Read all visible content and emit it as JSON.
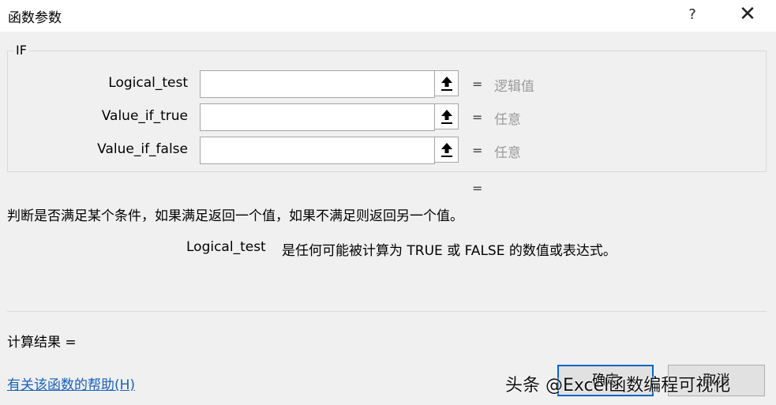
{
  "window": {
    "title": "函数参数",
    "help_glyph": "?",
    "close_glyph": "✕"
  },
  "function": {
    "name": "IF",
    "args": [
      {
        "label": "Logical_test",
        "value": "",
        "type": "逻辑值"
      },
      {
        "label": "Value_if_true",
        "value": "",
        "type": "任意"
      },
      {
        "label": "Value_if_false",
        "value": "",
        "type": "任意"
      }
    ],
    "equals": "=",
    "result_equals": "=",
    "description": "判断是否满足某个条件，如果满足返回一个值，如果不满足则返回另一个值。",
    "arg_help_name": "Logical_test",
    "arg_help_text": "是任何可能被计算为 TRUE 或 FALSE 的数值或表达式。"
  },
  "footer": {
    "calc_result": "计算结果 =",
    "help_link": "有关该函数的帮助(H)",
    "ok_label": "确定",
    "cancel_label": "取消"
  },
  "watermark": "头条 @Excel函数编程可视化",
  "icons": {
    "collapse": "collapse-dialog-icon"
  }
}
